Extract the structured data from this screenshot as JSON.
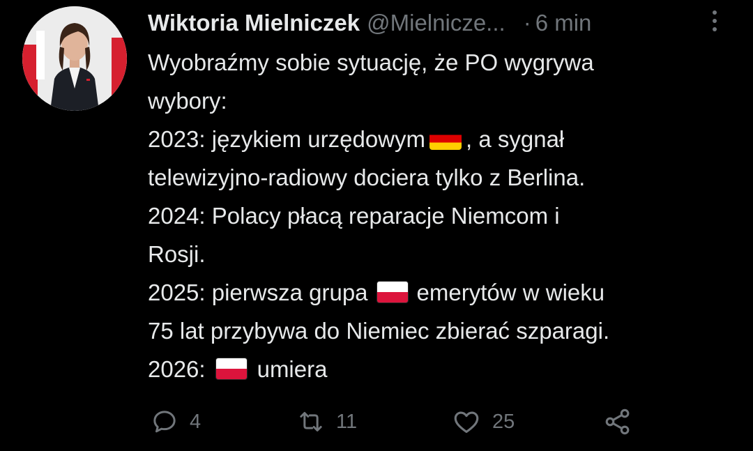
{
  "author": {
    "name": "Wiktoria Mielniczek",
    "handle": "@Mielnicze...",
    "separator": "·",
    "time": "6 min"
  },
  "tweet_lines": [
    "Wyobraźmy sobie sytuację, że PO wygrywa",
    "wybory:",
    {
      "before": "2023: językiem urzędowym",
      "flag": "germany-flag",
      "after": ", a sygnał"
    },
    "telewizyjno-radiowy dociera tylko z Berlina.",
    "2024: Polacy płacą reparacje Niemcom i",
    "Rosji.",
    {
      "before": "2025: pierwsza grupa",
      "flag": "poland-flag",
      "after": "emerytów w wieku"
    },
    "75 lat przybywa do Niemiec zbierać szparagi.",
    {
      "before": "2026:",
      "flag": "poland-flag",
      "after": "umiera"
    }
  ],
  "actions": {
    "reply": {
      "icon": "reply-icon",
      "count": "4"
    },
    "retweet": {
      "icon": "retweet-icon",
      "count": "11"
    },
    "like": {
      "icon": "heart-icon",
      "count": "25"
    },
    "share": {
      "icon": "share-icon"
    }
  },
  "colors": {
    "background": "#000000",
    "text": "#e7e9ea",
    "muted": "#71767b"
  }
}
